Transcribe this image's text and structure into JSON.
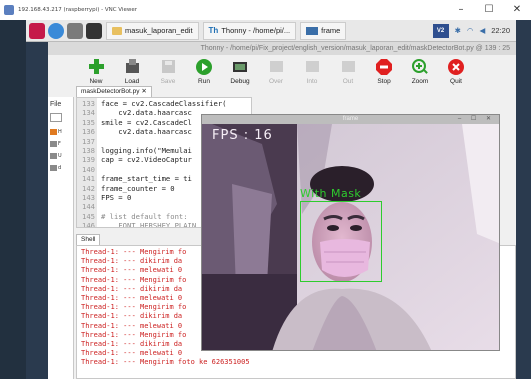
{
  "vnc": {
    "title": "192.168.43.217 (raspberrypi) - VNC Viewer",
    "minimize": "–",
    "maximize": "☐",
    "close": "✕"
  },
  "taskbar": {
    "tasks": [
      {
        "label": "masuk_laporan_edit",
        "icon": "folder-icon"
      },
      {
        "label": "Thonny - /home/pi/...",
        "icon": "thonny-icon"
      },
      {
        "label": "frame",
        "icon": "window-icon"
      }
    ],
    "vnc_badge": "V2",
    "clock": "22:20"
  },
  "thonny": {
    "title": "Thonny - /home/pi/Fix_project/english_version/masuk_laporan_edit/maskDetectorBot.py @ 139 : 25",
    "toolbar": [
      {
        "label": "New",
        "icon": "plus-icon",
        "color": "#2ca02c",
        "enabled": true
      },
      {
        "label": "Load",
        "icon": "load-icon",
        "color": "#444444",
        "enabled": true
      },
      {
        "label": "Save",
        "icon": "save-icon",
        "color": "#bbbbbb",
        "enabled": false
      },
      {
        "label": "Run",
        "icon": "run-icon",
        "color": "#2ca02c",
        "enabled": true
      },
      {
        "label": "Debug",
        "icon": "debug-icon",
        "color": "#333333",
        "enabled": true
      },
      {
        "label": "Over",
        "icon": "step-over-icon",
        "color": "#bbbbbb",
        "enabled": false
      },
      {
        "label": "Into",
        "icon": "step-into-icon",
        "color": "#bbbbbb",
        "enabled": false
      },
      {
        "label": "Out",
        "icon": "step-out-icon",
        "color": "#bbbbbb",
        "enabled": false
      },
      {
        "label": "Stop",
        "icon": "stop-icon",
        "color": "#e02020",
        "enabled": true
      },
      {
        "label": "Zoom",
        "icon": "zoom-icon",
        "color": "#2ca02c",
        "enabled": true
      },
      {
        "label": "Quit",
        "icon": "quit-icon",
        "color": "#e02020",
        "enabled": true
      }
    ],
    "files_label": "File",
    "files_items": [
      "H",
      "F",
      "U",
      "d"
    ],
    "editor_tab": "maskDetectorBot.py ✕",
    "editor_lines": [
      {
        "n": "133",
        "code": "face = cv2.CascadeClassifier(",
        "style": ""
      },
      {
        "n": "134",
        "code": "    cv2.data.haarcasc",
        "style": ""
      },
      {
        "n": "135",
        "code": "smile = cv2.CascadeCl",
        "style": ""
      },
      {
        "n": "136",
        "code": "    cv2.data.haarcasc",
        "style": ""
      },
      {
        "n": "137",
        "code": "",
        "style": ""
      },
      {
        "n": "138",
        "code": "logging.info(\"Memulai",
        "style": ""
      },
      {
        "n": "139",
        "code": "cap = cv2.VideoCaptur",
        "style": ""
      },
      {
        "n": "140",
        "code": "",
        "style": ""
      },
      {
        "n": "141",
        "code": "frame_start_time = ti",
        "style": ""
      },
      {
        "n": "142",
        "code": "frame_counter = 0",
        "style": ""
      },
      {
        "n": "143",
        "code": "FPS = 0",
        "style": ""
      },
      {
        "n": "144",
        "code": "",
        "style": ""
      },
      {
        "n": "145",
        "code": "# list default font:",
        "style": "muted"
      },
      {
        "n": "146",
        "code": "    FONT_HERSHEY_PLAIN",
        "style": "muted"
      }
    ],
    "shell_tab": "Shell",
    "shell_lines": [
      "Thread-1: --- Mengirim fo",
      "Thread-1: --- dikirim da",
      "Thread-1: --- melewati 0",
      "Thread-1: --- Mengirim fo",
      "Thread-1: --- dikirim da",
      "Thread-1: --- melewati 0",
      "Thread-1: --- Mengirim fo",
      "Thread-1: --- dikirim da",
      "Thread-1: --- melewati 0",
      "Thread-1: --- Mengirim fo",
      "Thread-1: --- dikirim da",
      "Thread-1: --- melewati 0",
      "Thread-1: --- Mengirim foto ke 626351005"
    ]
  },
  "frame_window": {
    "title": "frame",
    "controls": "– ☐ ✕",
    "fps_overlay": "FPS : 16",
    "detection_label": "With Mask"
  }
}
